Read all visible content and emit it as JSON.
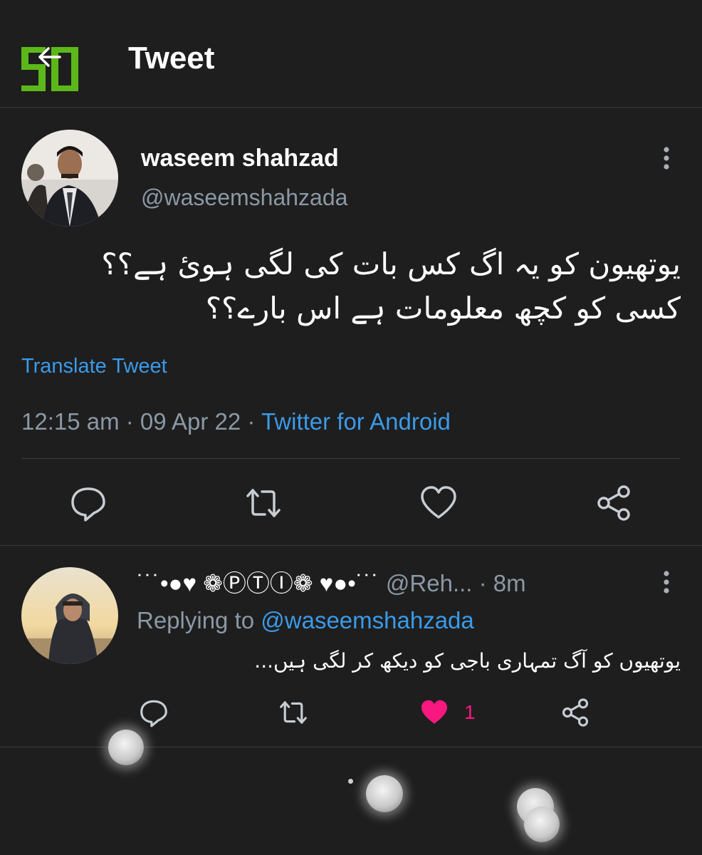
{
  "header": {
    "title": "Tweet",
    "logo_icon": "logo-50-icon",
    "back_icon": "back-arrow-icon"
  },
  "tweet": {
    "author_name": "waseem shahzad",
    "author_handle": "@waseemshahzada",
    "text_line1": "یوتھیون کو یہ اگ کس بات کی لگی ہوئ ہے؟؟",
    "text_line2": "کسی کو کچھ معلومات ہے اس بارے؟؟",
    "translate_label": "Translate Tweet",
    "time": "12:15 am",
    "date": "09 Apr 22",
    "separator": " · ",
    "source": "Twitter for Android",
    "actions": [
      "reply-icon",
      "retweet-icon",
      "like-icon",
      "share-icon"
    ]
  },
  "reply": {
    "author_name": "˙˙˙•●♥ ❁ⓅⓉⒾ❁ ♥●•˙˙˙",
    "author_handle": "@Reh...",
    "time": " · 8m",
    "replying_prefix": "Replying to ",
    "replying_to": "@waseemshahzada",
    "text": "یوتھیوں کو آگ تمہاری باجی کو دیکھ کر لگی ہیں...",
    "like_count": "1",
    "actions": [
      "reply-icon",
      "retweet-icon",
      "liked-heart-icon",
      "share-icon"
    ]
  },
  "colors": {
    "background": "#1e1e1e",
    "accent_blue": "#3b9ae8",
    "muted": "#8b98a5",
    "like_pink": "#f91880",
    "logo_green": "#5cb81a"
  }
}
